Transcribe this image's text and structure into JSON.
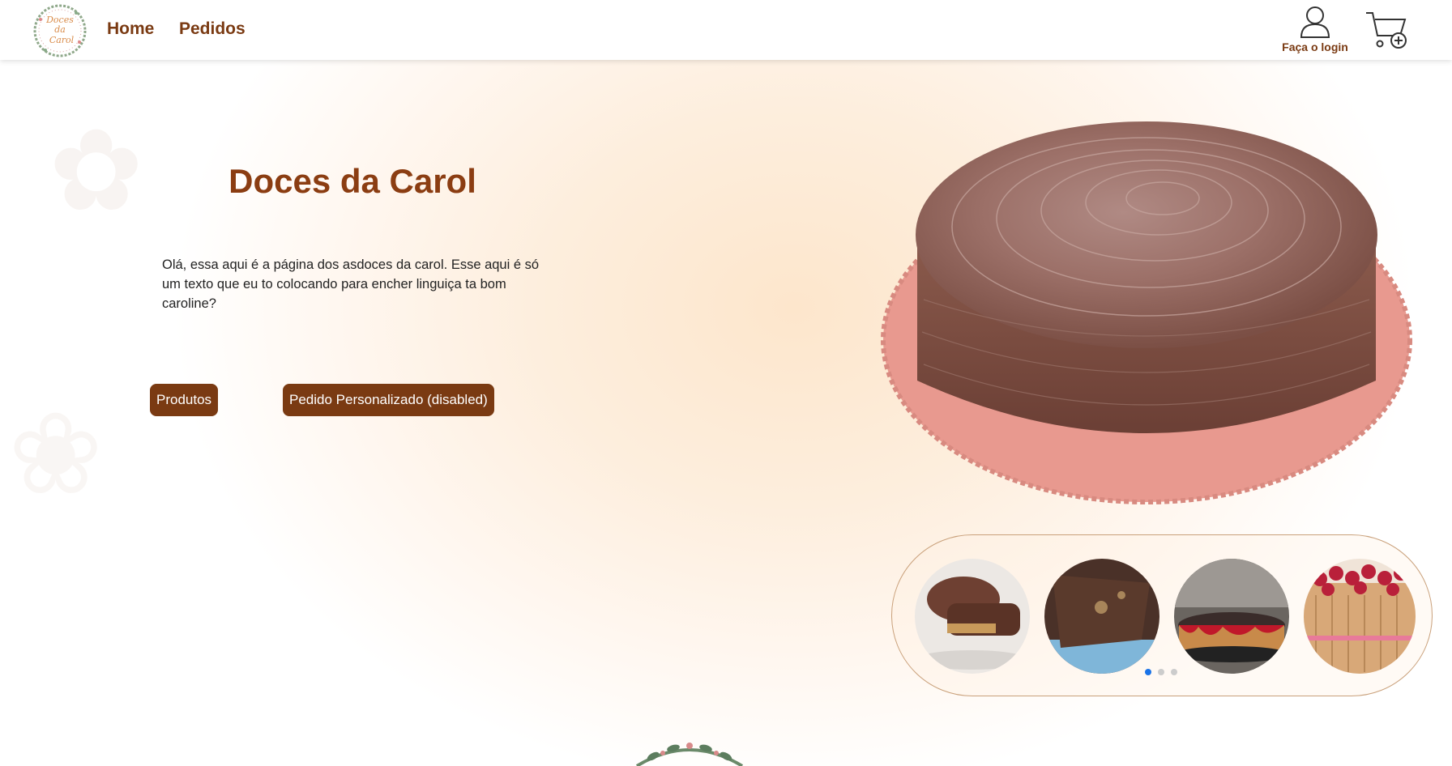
{
  "nav": {
    "logo_text": [
      "Doces",
      "da",
      "Carol"
    ],
    "home": "Home",
    "pedidos": "Pedidos",
    "login_label": "Faça o login"
  },
  "hero": {
    "title": "Doces da Carol",
    "text": "Olá, essa aqui é a página dos asdoces da carol. Esse aqui é só um texto que eu to colocando para encher linguiça ta bom caroline?",
    "btn_produtos": "Produtos",
    "btn_personalizado": "Pedido Personalizado (disabled)"
  },
  "carousel": {
    "items": [
      "chocolate-bonbon",
      "chocolate-cake-slice",
      "cheesecake-red-berry",
      "charlotte-berries"
    ],
    "active_dot": 0,
    "dot_count": 3
  },
  "colors": {
    "brand": "#7a3a12",
    "title": "#8b3d12",
    "dot_active": "#1a73e8"
  }
}
